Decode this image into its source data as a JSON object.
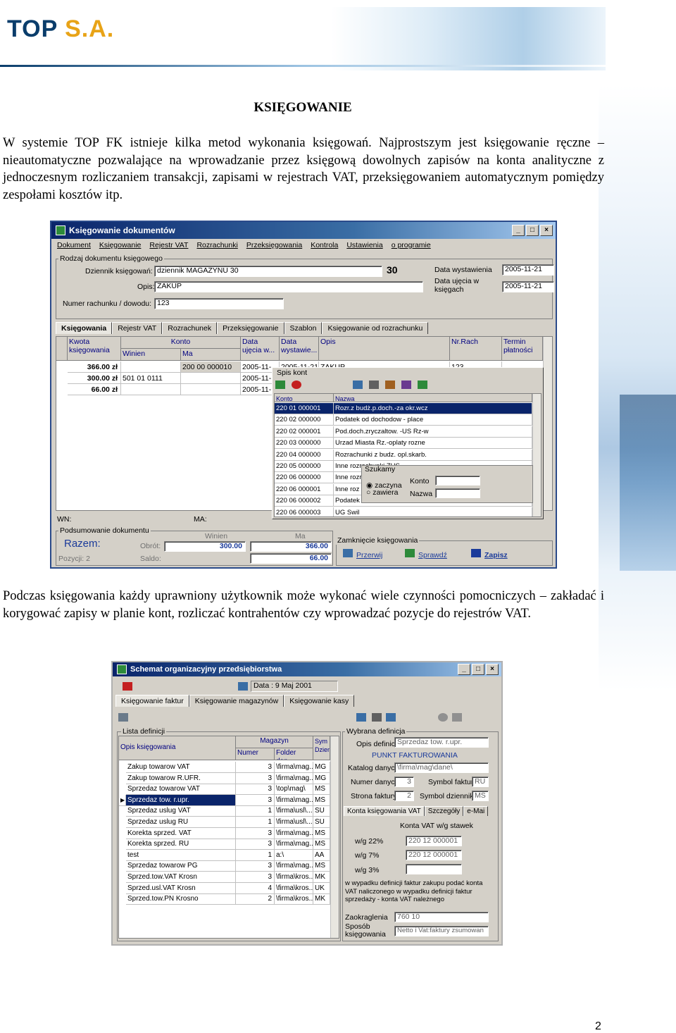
{
  "header": {
    "logo_top": "TOP",
    "logo_sa": "S.A."
  },
  "title": "KSIĘGOWANIE",
  "paragraph1": "W systemie TOP FK istnieje kilka metod wykonania księgowań. Najprostszym jest księgowanie ręczne – nieautomatyczne pozwalające na wprowadzanie przez księgową dowolnych zapisów na konta analityczne z jednoczesnym rozliczaniem transakcji, zapisami w rejestrach VAT, przeksięgowaniem automatycznym pomiędzy zespołami kosztów itp.",
  "paragraph2": "Podczas księgowania każdy uprawniony użytkownik może wykonać wiele czynności pomocniczych – zakładać i korygować zapisy w planie kont, rozliczać kontrahentów czy wprowadzać pozycje do rejestrów VAT.",
  "page_number": "2",
  "win1": {
    "title": "Księgowanie dokumentów",
    "menu": [
      "Dokument",
      "Księgowanie",
      "Rejestr VAT",
      "Rozrachunki",
      "Przeksięgowania",
      "Kontrola",
      "Ustawienia",
      "o programie"
    ],
    "group_label": "Rodzaj dokumentu księgowego",
    "dziennik_label": "Dziennik księgowań:",
    "dziennik_value": "dziennik MAGAZYNU 30",
    "dziennik_num": "30",
    "opis_label": "Opis:",
    "opis_value": "ZAKUP",
    "numer_label": "Numer rachunku / dowodu:",
    "numer_value": "123",
    "data_wyst_label": "Data wystawienia",
    "data_wyst_value": "2005-11-21",
    "data_ujecia_label": "Data ujęcia w księgach",
    "data_ujecia_value": "2005-11-21",
    "tabs": [
      "Księgowania",
      "Rejestr VAT",
      "Rozrachunek",
      "Przeksięgowanie",
      "Szablon",
      "Księgowanie od rozrachunku"
    ],
    "cols": {
      "kwota": "Kwota księgowania",
      "konto": "Konto",
      "winien": "Winien",
      "ma": "Ma",
      "data_ujecia": "Data ujęcia w...",
      "data_wyst": "Data wystawie...",
      "opis": "Opis",
      "nr_rach": "Nr.Rach",
      "termin": "Termin płatności"
    },
    "rows": [
      {
        "kwota": "366.00 zł",
        "winien": "",
        "ma": "200 00 000010",
        "data": "2005-11-",
        "data2": "2005-11-21",
        "opis": "ZAKUP",
        "nr": "123"
      },
      {
        "kwota": "300.00 zł",
        "winien": "501 01 0111",
        "ma": "",
        "data": "2005-11-",
        "data2": "",
        "opis": "",
        "nr": ""
      },
      {
        "kwota": "66.00 zł",
        "winien": "",
        "ma": "",
        "data": "2005-11-",
        "data2": "",
        "opis": "",
        "nr": ""
      }
    ],
    "spis": {
      "title": "Spis kont",
      "col_konto": "Konto",
      "col_nazwa": "Nazwa",
      "rows": [
        [
          "220 01 000001",
          "Rozr.z budż.p.doch.-za okr.wcz"
        ],
        [
          "220 02 000000",
          "Podatek od dochodow - place"
        ],
        [
          "220 02 000001",
          "Pod.doch.zryczaltow. -US Rz-w"
        ],
        [
          "220 03 000000",
          "Urzad Miasta Rz.-oplaty rozne"
        ],
        [
          "220 04 000000",
          "Rozrachunki z budz. opl.skarb."
        ],
        [
          "220 05 000000",
          "Inne rozrachunki     ZUS"
        ],
        [
          "220 06 000000",
          "Inne rozrachunki z p.od nieruch."
        ],
        [
          "220 06 000001",
          "Inne roz"
        ],
        [
          "220 06 000002",
          "Podatek"
        ],
        [
          "220 06 000003",
          "UG Swil"
        ]
      ],
      "szukamy": "Szukamy",
      "opt1": "zaczyna",
      "opt2": "zawiera",
      "s_konto": "Konto",
      "s_nazwa": "Nazwa"
    },
    "wn_label": "WN:",
    "ma_label": "MA:",
    "podsum_label": "Podsumowanie dokumentu",
    "razem": "Razem:",
    "pozycji": "Pozycji: 2",
    "obrot": "Obrót:",
    "saldo": "Saldo:",
    "winien_h": "Winien",
    "ma_h": "Ma",
    "obrot_wn": "300.00",
    "obrot_ma": "366.00",
    "saldo_ma": "66.00",
    "zamkniecie": "Zamknięcie księgowania",
    "btn_przerwij": "Przerwij",
    "btn_sprawdz": "Sprawdź",
    "btn_zapisz": "Zapisz"
  },
  "win2": {
    "title": "Schemat organizacyjny przedsiębiorstwa",
    "data_label": "Data : 9 Maj 2001",
    "tabs": [
      "Księgowanie faktur",
      "Księgowanie magazynów",
      "Księgowanie kasy"
    ],
    "lista_label": "Lista definicji",
    "col_opis": "Opis księgowania",
    "col_magazyn": "Magazyn",
    "col_numer": "Numer",
    "col_folder": "Folder dan...",
    "col_sym": "Sym Dzien",
    "rows": [
      [
        "Zakup towarow VAT",
        "3",
        "\\firma\\mag...",
        "MG"
      ],
      [
        "Zakup towarow R.UFR.",
        "3",
        "\\firma\\mag...",
        "MG"
      ],
      [
        "Sprzedaz towarow VAT",
        "3",
        "\\top\\mag\\",
        "MS"
      ],
      [
        "Sprzedaz tow. r.upr.",
        "3",
        "\\firma\\mag...",
        "MS"
      ],
      [
        "Sprzedaz uslug VAT",
        "1",
        "\\firma\\usl\\...",
        "SU"
      ],
      [
        "Sprzedaz uslug RU",
        "1",
        "\\firma\\usl\\...",
        "SU"
      ],
      [
        "Korekta sprzed. VAT",
        "3",
        "\\firma\\mag...",
        "MS"
      ],
      [
        "Korekta sprzed. RU",
        "3",
        "\\firma\\mag...",
        "MS"
      ],
      [
        "test",
        "1",
        "a:\\",
        "AA"
      ],
      [
        "Sprzedaz towarow PG",
        "3",
        "\\firma\\mag...",
        "MS"
      ],
      [
        "Sprzed.tow.VAT Krosn",
        "3",
        "\\firma\\kros...",
        "MK"
      ],
      [
        "Sprzed.usl.VAT Krosn",
        "4",
        "\\firma\\kros...",
        "UK"
      ],
      [
        "Sprzed.tow.PN Krosno",
        "2",
        "\\firma\\kros...",
        "MK"
      ]
    ],
    "wybrana_label": "Wybrana definicja",
    "opis_def_label": "Opis definicji",
    "opis_def_value": "Sprzedaz tow. r.upr.",
    "punkt": "PUNKT FAKTUROWANIA",
    "katalog_label": "Katalog danych",
    "katalog_value": "\\firma\\mag\\dane\\",
    "numer_danych_label": "Numer danych",
    "numer_danych_value": "3",
    "symbol_faktury_label": "Symbol faktury",
    "symbol_faktury_value": "RU",
    "strona_label": "Strona faktury",
    "strona_value": "2",
    "symbol_dziennika_label": "Symbol dziennika",
    "symbol_dziennika_value": "MS",
    "subtabs": [
      "Konta księgowania VAT",
      "Szczegóły",
      "e-Mai"
    ],
    "konta_vat_label": "Konta VAT w/g stawek",
    "vat22_label": "w/g 22%",
    "vat22_value": "220 12 000001",
    "vat7_label": "w/g 7%",
    "vat7_value": "220 12 000001",
    "vat3_label": "w/g 3%",
    "vat3_value": "",
    "note": "w wypadku definicji faktur zakupu podać konta VAT naliczonego w wypadku definicji faktur sprzedaży - konta VAT należnego",
    "zaokr_label": "Zaokraglenia",
    "zaokr_value": "760 10",
    "sposob_label": "Sposób księgowania",
    "sposob_value": "Netto i Vat:faktury zsumowan"
  }
}
